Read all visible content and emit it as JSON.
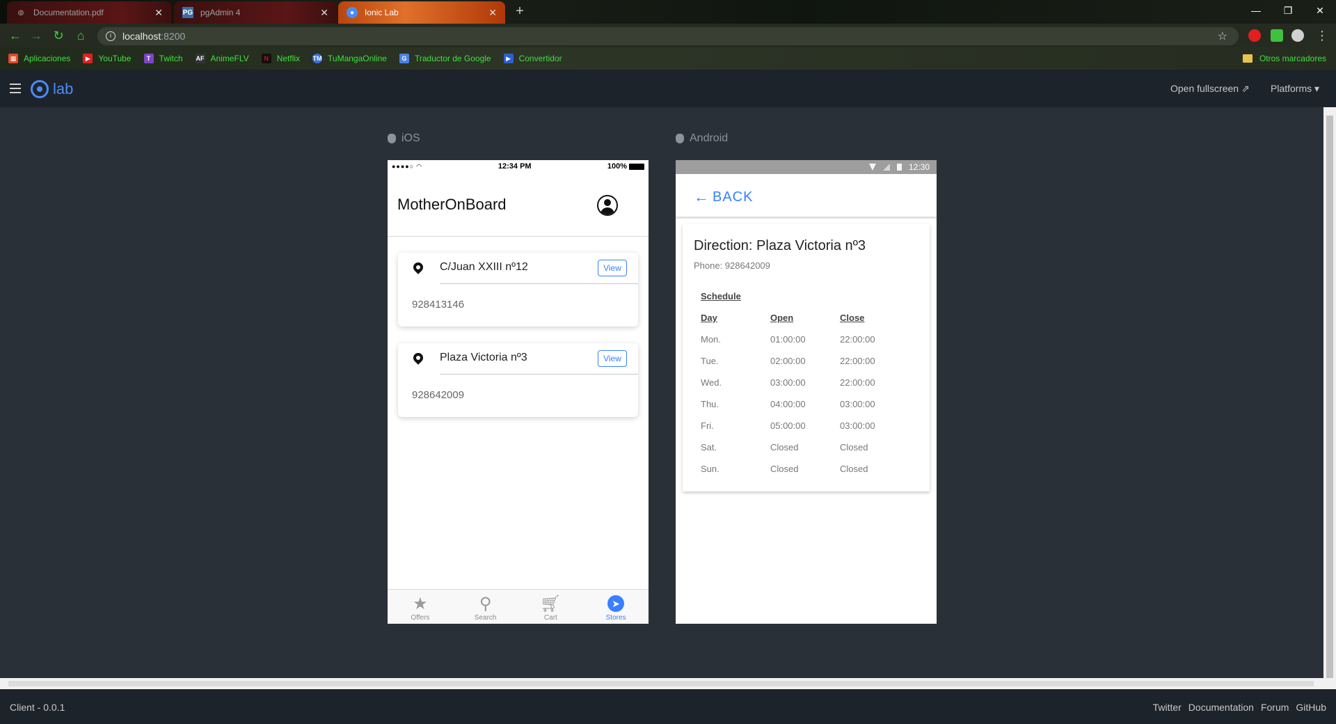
{
  "browser": {
    "tabs": [
      {
        "label": "Documentation.pdf",
        "icon": "globe-icon"
      },
      {
        "label": "pgAdmin 4",
        "icon": "pgadmin-icon"
      },
      {
        "label": "Ionic Lab",
        "icon": "ionic-icon"
      }
    ],
    "url_host": "localhost",
    "url_port": ":8200",
    "bookmarks": [
      {
        "label": "Aplicaciones",
        "color": "#e04a2a"
      },
      {
        "label": "YouTube",
        "color": "#e02020"
      },
      {
        "label": "Twitch",
        "color": "#7b45c8"
      },
      {
        "label": "AnimeFLV",
        "color": "#333333"
      },
      {
        "label": "Netflix",
        "color": "#d01010"
      },
      {
        "label": "TuMangaOnline",
        "color": "#3a6ee0"
      },
      {
        "label": "Traductor de Google",
        "color": "#4a80e8"
      },
      {
        "label": "Convertidor",
        "color": "#2a60d0"
      }
    ],
    "other_bookmarks": "Otros marcadores"
  },
  "lab": {
    "logo_text": "lab",
    "open_fullscreen": "Open fullscreen",
    "platforms": "Platforms",
    "ios_label": "iOS",
    "android_label": "Android",
    "version": "Client - 0.0.1",
    "footer_links": [
      "Twitter",
      "Documentation",
      "Forum",
      "GitHub"
    ]
  },
  "ios": {
    "status_time": "12:34 PM",
    "battery": "100%",
    "title": "MotherOnBoard",
    "stores": [
      {
        "address": "C/Juan XXIII nº12",
        "phone": "928413146",
        "button": "View"
      },
      {
        "address": "Plaza Victoria nº3",
        "phone": "928642009",
        "button": "View"
      }
    ],
    "tabs": [
      {
        "label": "Offers",
        "icon": "star-icon"
      },
      {
        "label": "Search",
        "icon": "search-icon"
      },
      {
        "label": "Cart",
        "icon": "cart-icon"
      },
      {
        "label": "Stores",
        "icon": "compass-icon"
      }
    ],
    "accent": "#3880ff"
  },
  "android": {
    "status_time": "12:30",
    "back_label": "BACK",
    "direction": "Direction: Plaza Victoria nº3",
    "phone": "Phone: 928642009",
    "schedule_title": "Schedule",
    "headers": [
      "Day",
      "Open",
      "Close"
    ],
    "rows": [
      [
        "Mon.",
        "01:00:00",
        "22:00:00"
      ],
      [
        "Tue.",
        "02:00:00",
        "22:00:00"
      ],
      [
        "Wed.",
        "03:00:00",
        "22:00:00"
      ],
      [
        "Thu.",
        "04:00:00",
        "03:00:00"
      ],
      [
        "Fri.",
        "05:00:00",
        "03:00:00"
      ],
      [
        "Sat.",
        "Closed",
        "Closed"
      ],
      [
        "Sun.",
        "Closed",
        "Closed"
      ]
    ]
  }
}
